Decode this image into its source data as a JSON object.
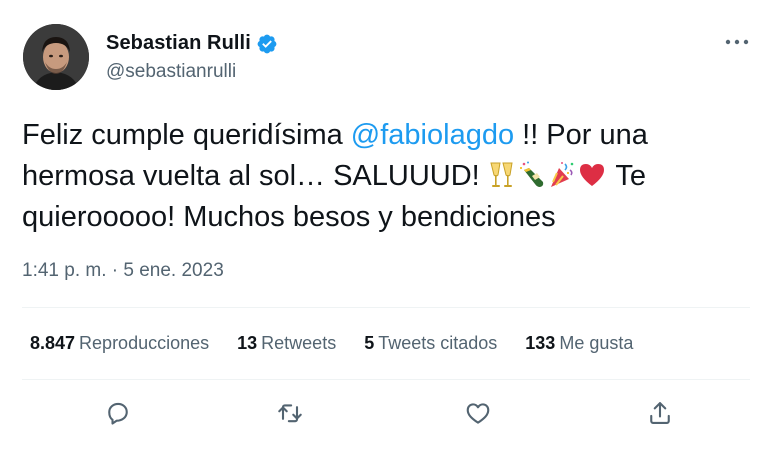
{
  "author": {
    "display_name": "Sebastian Rulli",
    "handle": "@sebastianrulli",
    "verified": true,
    "avatar_icon": "profile-photo"
  },
  "tweet": {
    "text_part1": "Feliz cumple queridísima ",
    "mention": "@fabiolagdo",
    "text_part2": " !! Por una hermosa vuelta al sol… SALUUUD! ",
    "emojis": [
      "clinking-glasses-emoji",
      "champagne-bottle-emoji",
      "party-popper-emoji",
      "red-heart-emoji"
    ],
    "text_part3": " Te quierooooo! Muchos besos y bendiciones",
    "time": "1:41 p. m.",
    "separator": "·",
    "date": "5 ene. 2023"
  },
  "stats": {
    "views_count": "8.847",
    "views_label": "Reproducciones",
    "retweets_count": "13",
    "retweets_label": "Retweets",
    "quotes_count": "5",
    "quotes_label": "Tweets citados",
    "likes_count": "133",
    "likes_label": "Me gusta"
  },
  "actions": [
    "reply-icon",
    "retweet-icon",
    "like-icon",
    "share-icon"
  ],
  "colors": {
    "link": "#1d9bf0",
    "secondary_text": "#536471",
    "primary_text": "#0f1419",
    "divider": "#eff3f4"
  }
}
